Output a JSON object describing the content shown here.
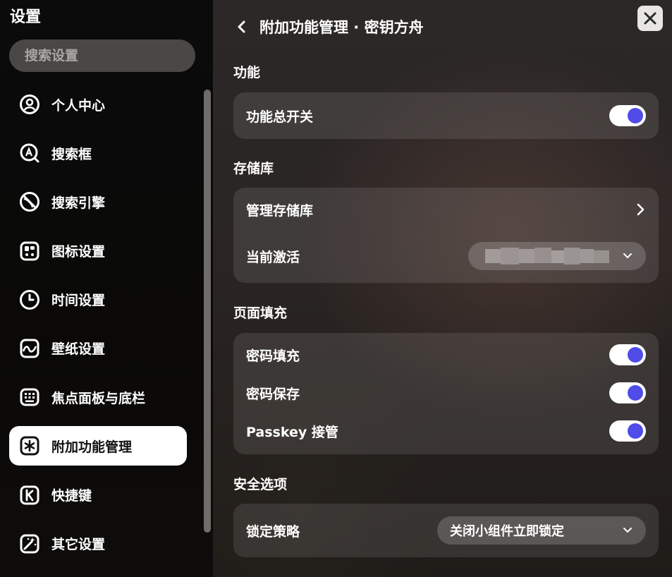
{
  "sidebar": {
    "title": "设置",
    "search": {
      "placeholder": "搜索设置",
      "icon": "search-icon"
    },
    "items": [
      {
        "label": "个人中心",
        "icon": "user-circle-icon"
      },
      {
        "label": "搜索框",
        "icon": "search-box-icon"
      },
      {
        "label": "搜索引擎",
        "icon": "search-engine-icon"
      },
      {
        "label": "图标设置",
        "icon": "icon-grid-icon"
      },
      {
        "label": "时间设置",
        "icon": "clock-icon"
      },
      {
        "label": "壁纸设置",
        "icon": "wallpaper-icon"
      },
      {
        "label": "焦点面板与底栏",
        "icon": "keyboard-icon"
      },
      {
        "label": "附加功能管理",
        "icon": "addon-icon",
        "active": true
      },
      {
        "label": "快捷键",
        "icon": "shortcut-icon"
      },
      {
        "label": "其它设置",
        "icon": "magic-wand-icon"
      }
    ]
  },
  "header": {
    "back_icon": "chevron-left-icon",
    "title": "附加功能管理 · 密钥方舟",
    "close_icon": "close-icon"
  },
  "sections": {
    "features": {
      "title": "功能",
      "master_switch": {
        "label": "功能总开关",
        "on": true
      }
    },
    "vault": {
      "title": "存储库",
      "manage": {
        "label": "管理存储库",
        "icon": "chevron-right-icon"
      },
      "current": {
        "label": "当前激活",
        "value": "",
        "value_obscured": true
      }
    },
    "autofill": {
      "title": "页面填充",
      "password_fill": {
        "label": "密码填充",
        "on": true
      },
      "password_save": {
        "label": "密码保存",
        "on": true
      },
      "passkey": {
        "label": "Passkey 接管",
        "on": true
      }
    },
    "security": {
      "title": "安全选项",
      "lock_policy": {
        "label": "锁定策略",
        "value": "关闭小组件立即锁定"
      }
    }
  },
  "colors": {
    "toggle_on_knob": "#4f4ce8",
    "toggle_track": "#ffffff",
    "active_nav_bg": "#ffffff"
  }
}
